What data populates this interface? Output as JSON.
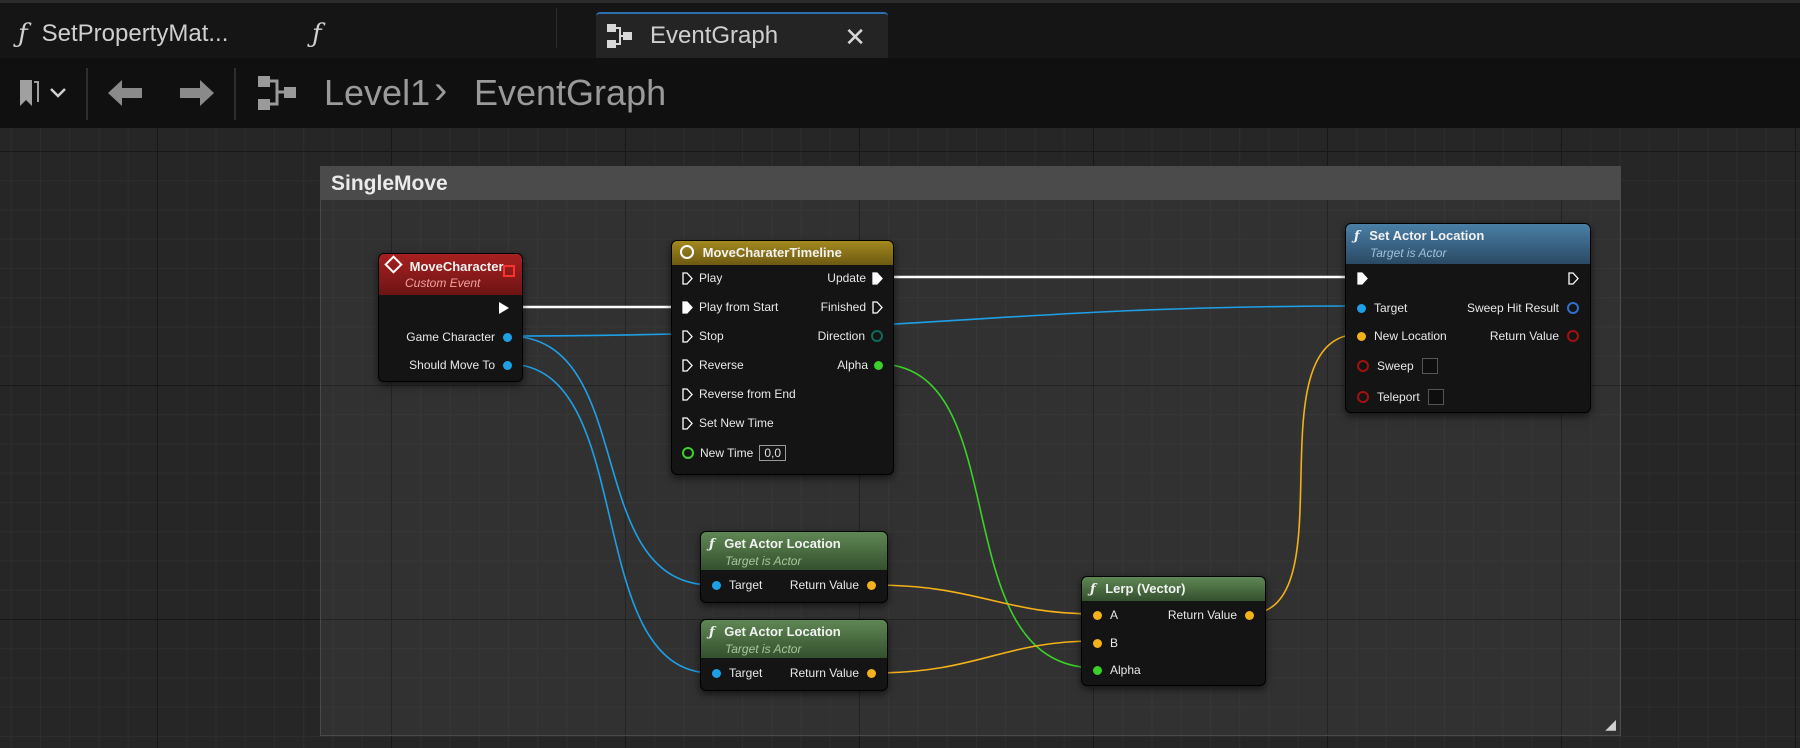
{
  "tabs": [
    {
      "label": "SetPropertyMat...",
      "icon": "function-icon"
    },
    {
      "label": "",
      "icon": "function-icon"
    },
    {
      "label": "EventGraph",
      "icon": "graph-icon",
      "close": "✕"
    }
  ],
  "breadcrumb": {
    "level": "Level1",
    "separator": "›",
    "graph": "EventGraph"
  },
  "comment": {
    "title": "SingleMove"
  },
  "nodes": {
    "move_character": {
      "title": "MoveCharacter",
      "subtitle": "Custom Event",
      "pins": {
        "game_character": "Game Character",
        "should_move_to": "Should Move To"
      }
    },
    "timeline": {
      "title": "MoveCharaterTimeline",
      "inputs": {
        "play": "Play",
        "play_from_start": "Play from Start",
        "stop": "Stop",
        "reverse": "Reverse",
        "reverse_from_end": "Reverse from End",
        "set_new_time": "Set New Time",
        "new_time": "New Time"
      },
      "new_time_value": "0,0",
      "outputs": {
        "update": "Update",
        "finished": "Finished",
        "direction": "Direction",
        "alpha": "Alpha"
      }
    },
    "set_actor_location": {
      "title": "Set Actor Location",
      "subtitle": "Target is Actor",
      "pins": {
        "target": "Target",
        "new_location": "New Location",
        "sweep": "Sweep",
        "teleport": "Teleport",
        "sweep_hit_result": "Sweep Hit Result",
        "return_value": "Return Value"
      }
    },
    "get_actor_location_1": {
      "title": "Get Actor Location",
      "subtitle": "Target is Actor",
      "pins": {
        "target": "Target",
        "return_value": "Return Value"
      }
    },
    "get_actor_location_2": {
      "title": "Get Actor Location",
      "subtitle": "Target is Actor",
      "pins": {
        "target": "Target",
        "return_value": "Return Value"
      }
    },
    "lerp": {
      "title": "Lerp (Vector)",
      "pins": {
        "a": "A",
        "b": "B",
        "alpha": "Alpha",
        "return_value": "Return Value"
      }
    }
  },
  "colors": {
    "exec": "#ffffff",
    "object": "#1ea0e6",
    "vector": "#f3b11a",
    "float": "#3bd12a",
    "struct": "#2f6fd0",
    "bool": "#a31010",
    "event_header": "#8e1a1a",
    "timeline_header": "#8d7418",
    "function_header": "#3b6a8e",
    "pure_header": "#56784d",
    "accent_tab": "#2f6fb0"
  }
}
